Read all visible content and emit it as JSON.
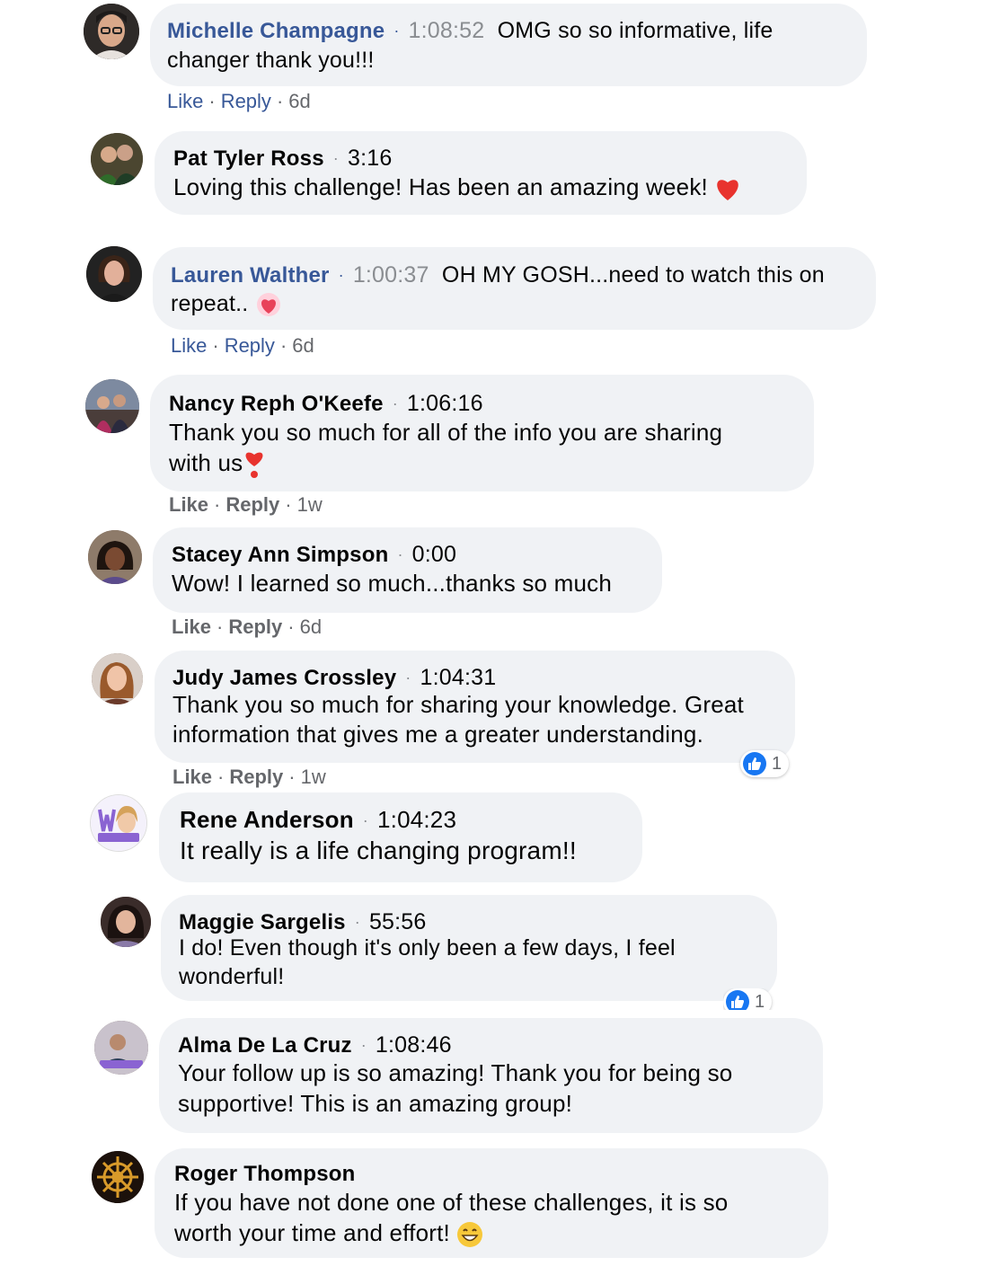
{
  "comments": [
    {
      "name": "Michelle Champagne",
      "time": "1:08:52",
      "text1": "OMG so so informative, life",
      "text2": "changer thank you!!!",
      "actions": {
        "like": "Like",
        "reply": "Reply",
        "age": "6d"
      }
    },
    {
      "name": "Pat Tyler Ross",
      "time": "3:16",
      "text1": "Loving this challenge! Has been an amazing week!"
    },
    {
      "name": "Lauren Walther",
      "time": "1:00:37",
      "text1": "OH MY GOSH...need to watch this on",
      "text2": "repeat..",
      "actions": {
        "like": "Like",
        "reply": "Reply",
        "age": "6d"
      }
    },
    {
      "name": "Nancy Reph O'Keefe",
      "time": "1:06:16",
      "text1": "Thank you so much for all of the info you are sharing",
      "text2": "with us",
      "actions": {
        "like": "Like",
        "reply": "Reply",
        "age": "1w"
      }
    },
    {
      "name": "Stacey Ann Simpson",
      "time": "0:00",
      "text1": "Wow! I learned so much...thanks so much",
      "actions": {
        "like": "Like",
        "reply": "Reply",
        "age": "6d"
      }
    },
    {
      "name": "Judy James Crossley",
      "time": "1:04:31",
      "text1": "Thank you so much for sharing your knowledge. Great",
      "text2": "information that gives me a greater understanding.",
      "actions": {
        "like": "Like",
        "reply": "Reply",
        "age": "1w"
      },
      "reactions": "1"
    },
    {
      "name": "Rene Anderson",
      "time": "1:04:23",
      "text1": "It really is a life changing program!!"
    },
    {
      "name": "Maggie Sargelis",
      "time": "55:56",
      "text1": "I do! Even though it's only been a few days, I feel",
      "text2": "wonderful!",
      "reactions": "1"
    },
    {
      "name": "Alma De La Cruz",
      "time": "1:08:46",
      "text1": "Your follow up is so amazing! Thank you for being so",
      "text2": "supportive! This is an amazing group!"
    },
    {
      "name": "Roger Thompson",
      "text1": "If you have not done one of these challenges, it is so",
      "text2": "worth your time and effort!"
    }
  ],
  "colors": {
    "link": "#385898",
    "bubble": "#f0f2f5",
    "meta": "#65676b",
    "like_blue": "#1877f2"
  },
  "icons": {
    "dot": "·",
    "heart": "heart-emoji",
    "like": "thumbs-up-icon",
    "grin": "grinning-emoji"
  }
}
